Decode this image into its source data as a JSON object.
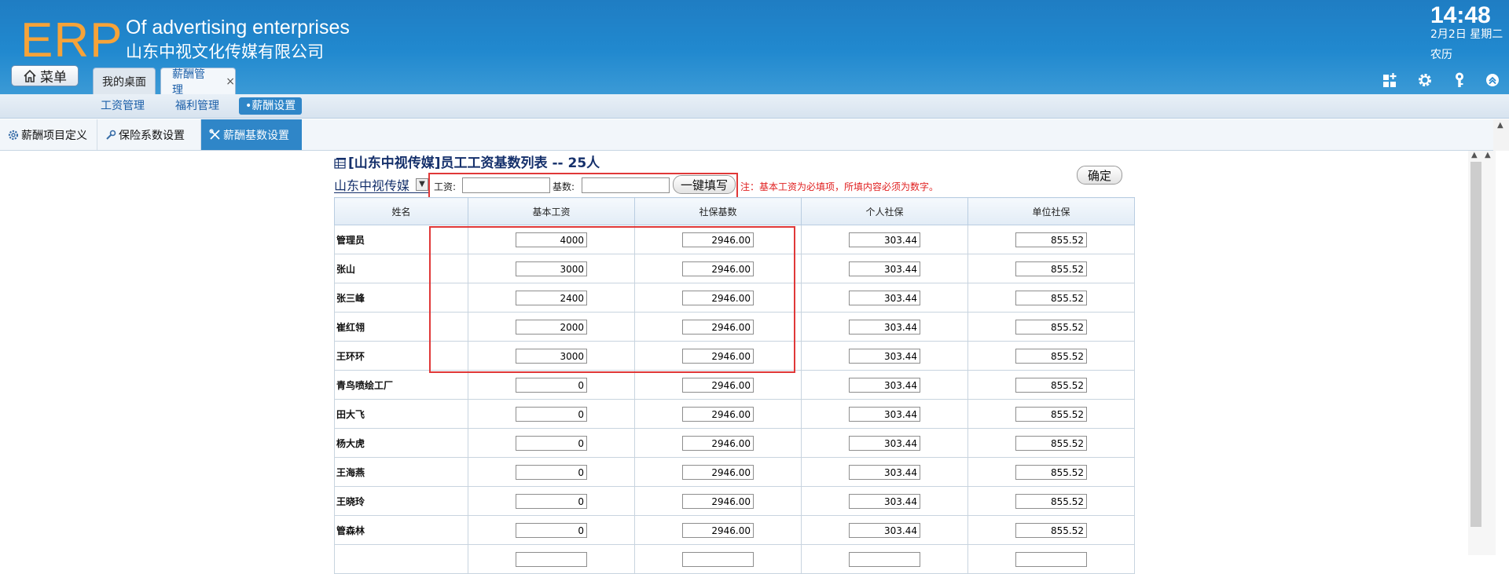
{
  "header": {
    "logo": "ERP",
    "title_en": "Of advertising enterprises",
    "title_cn": "山东中视文化传媒有限公司",
    "time": "14:48",
    "date": "2月2日 星期二",
    "lunar": "农历",
    "menu_label": "菜单",
    "tabs": [
      {
        "label": "我的桌面"
      },
      {
        "label": "薪酬管理",
        "close": "×"
      }
    ],
    "tool_icons": [
      "add-widget-icon",
      "gear-icon",
      "key-icon",
      "collapse-icon"
    ]
  },
  "subnav": {
    "items": [
      {
        "label": "工资管理"
      },
      {
        "label": "福利管理"
      },
      {
        "label": "•薪酬设置",
        "active": true
      }
    ]
  },
  "section_tabs": {
    "items": [
      {
        "label": "薪酬项目定义",
        "icon": "gear-icon"
      },
      {
        "label": "保险系数设置",
        "icon": "wrench-icon"
      },
      {
        "label": "薪酬基数设置",
        "icon": "tools-icon",
        "active": true
      }
    ]
  },
  "form": {
    "title": "[山东中视传媒]员工工资基数列表 -- 25人",
    "company_select": "山东中视传媒",
    "wage_label": "工资:",
    "wage_value": "",
    "base_label": "基数:",
    "base_value": "",
    "one_click_label": "一键填写",
    "note": "注：基本工资为必填项，所填内容必须为数字。",
    "confirm_label": "确定"
  },
  "table": {
    "headers": [
      "姓名",
      "基本工资",
      "社保基数",
      "个人社保",
      "单位社保"
    ],
    "rows": [
      [
        "管理员",
        "4000",
        "2946.00",
        "303.44",
        "855.52"
      ],
      [
        "张山",
        "3000",
        "2946.00",
        "303.44",
        "855.52"
      ],
      [
        "张三峰",
        "2400",
        "2946.00",
        "303.44",
        "855.52"
      ],
      [
        "崔红翎",
        "2000",
        "2946.00",
        "303.44",
        "855.52"
      ],
      [
        "王环环",
        "3000",
        "2946.00",
        "303.44",
        "855.52"
      ],
      [
        "青鸟喷绘工厂",
        "0",
        "2946.00",
        "303.44",
        "855.52"
      ],
      [
        "田大飞",
        "0",
        "2946.00",
        "303.44",
        "855.52"
      ],
      [
        "杨大虎",
        "0",
        "2946.00",
        "303.44",
        "855.52"
      ],
      [
        "王海燕",
        "0",
        "2946.00",
        "303.44",
        "855.52"
      ],
      [
        "王晓玲",
        "0",
        "2946.00",
        "303.44",
        "855.52"
      ],
      [
        "管森林",
        "0",
        "2946.00",
        "303.44",
        "855.52"
      ],
      [
        "",
        "",
        "",
        "",
        ""
      ]
    ]
  },
  "colors": {
    "header_blue": "#2189cf",
    "logo_orange": "#f6a339",
    "active_tab_blue": "#2f86c8",
    "highlight_red": "#e03838",
    "note_red": "#e02020"
  }
}
